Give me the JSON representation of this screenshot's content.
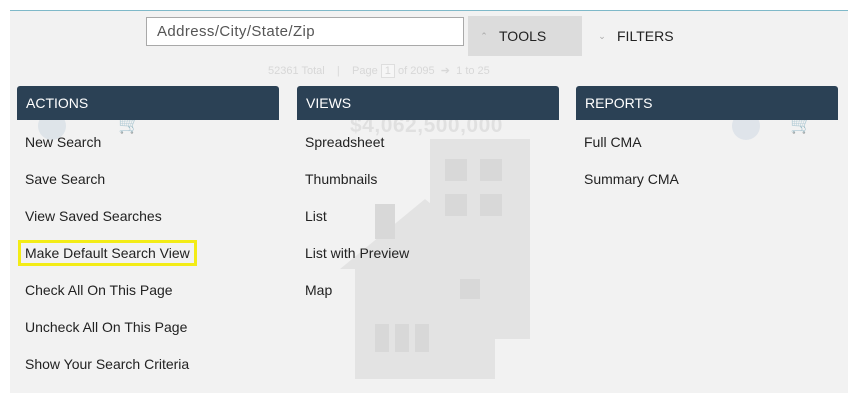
{
  "search": {
    "placeholder": "Address/City/State/Zip"
  },
  "toolbar": {
    "tools_label": "TOOLS",
    "tools_icon": "chevron-up-icon",
    "filters_label": "FILTERS",
    "filters_icon": "chevron-down-icon"
  },
  "background": {
    "results_total": "52361 Total",
    "page_label": "Page",
    "page_number": "1",
    "page_of": "of 2095",
    "range": "1 to 25",
    "price": "$4,062,500,000"
  },
  "menu": {
    "actions": {
      "header": "ACTIONS",
      "items": [
        "New Search",
        "Save Search",
        "View Saved Searches",
        "Make Default Search View",
        "Check All On This Page",
        "Uncheck All On This Page",
        "Show Your Search Criteria"
      ],
      "highlighted_item": "Make Default Search View"
    },
    "views": {
      "header": "VIEWS",
      "items": [
        "Spreadsheet",
        "Thumbnails",
        "List",
        "List with Preview",
        "Map"
      ]
    },
    "reports": {
      "header": "REPORTS",
      "items": [
        "Full CMA",
        "Summary CMA"
      ]
    }
  },
  "colors": {
    "header_bg": "#2b4155",
    "panel_bg": "#f2f2f2",
    "highlight": "#f3ec16",
    "tools_bg": "#dcdcdc"
  }
}
